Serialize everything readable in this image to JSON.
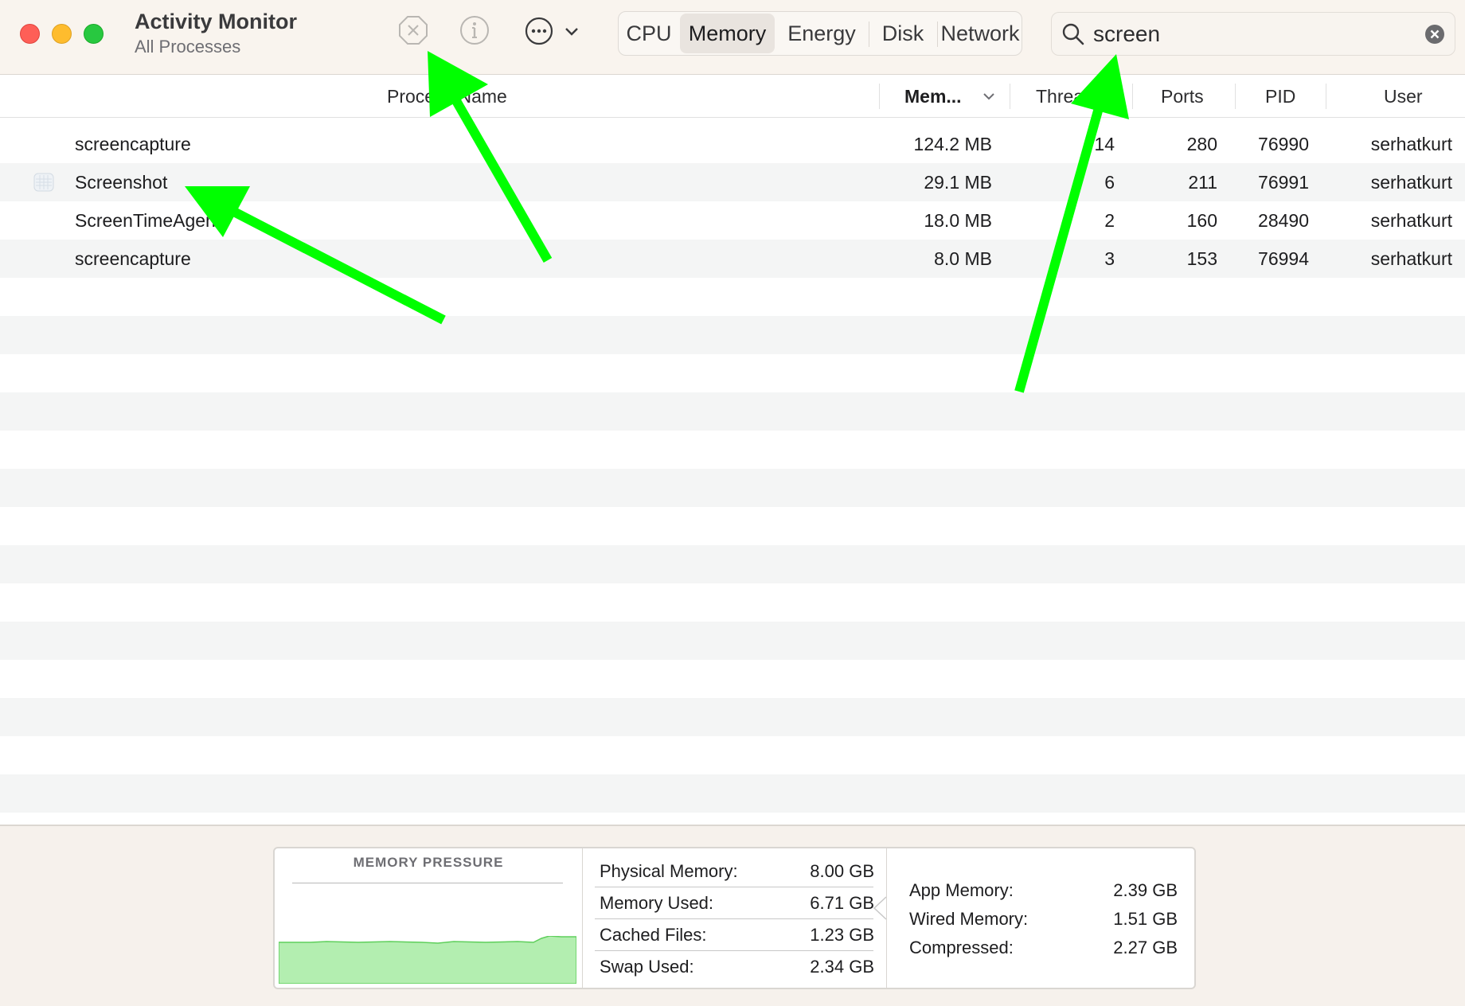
{
  "window": {
    "title": "Activity Monitor",
    "subtitle": "All Processes"
  },
  "toolbar": {
    "stop_icon": "stop-process-icon",
    "info_icon": "info-icon",
    "more_icon": "more-options-icon"
  },
  "tabs": [
    {
      "label": "CPU",
      "active": false
    },
    {
      "label": "Memory",
      "active": true
    },
    {
      "label": "Energy",
      "active": false
    },
    {
      "label": "Disk",
      "active": false
    },
    {
      "label": "Network",
      "active": false
    }
  ],
  "search": {
    "value": "screen"
  },
  "table": {
    "columns": {
      "process_name": "Process Name",
      "memory": "Mem...",
      "threads": "Threads",
      "ports": "Ports",
      "pid": "PID",
      "user": "User"
    },
    "rows": [
      {
        "name": "screencapture",
        "memory": "124.2 MB",
        "threads": "14",
        "ports": "280",
        "pid": "76990",
        "user": "serhatkurt"
      },
      {
        "name": "Screenshot",
        "memory": "29.1 MB",
        "threads": "6",
        "ports": "211",
        "pid": "76991",
        "user": "serhatkurt"
      },
      {
        "name": "ScreenTimeAgent",
        "memory": "18.0 MB",
        "threads": "2",
        "ports": "160",
        "pid": "28490",
        "user": "serhatkurt"
      },
      {
        "name": "screencapture",
        "memory": "8.0 MB",
        "threads": "3",
        "ports": "153",
        "pid": "76994",
        "user": "serhatkurt"
      }
    ]
  },
  "footer": {
    "pressure_title": "MEMORY PRESSURE",
    "physical_memory": {
      "label": "Physical Memory:",
      "value": "8.00 GB"
    },
    "memory_used": {
      "label": "Memory Used:",
      "value": "6.71 GB"
    },
    "cached_files": {
      "label": "Cached Files:",
      "value": "1.23 GB"
    },
    "swap_used": {
      "label": "Swap Used:",
      "value": "2.34 GB"
    },
    "app_memory": {
      "label": "App Memory:",
      "value": "2.39 GB"
    },
    "wired_memory": {
      "label": "Wired Memory:",
      "value": "1.51 GB"
    },
    "compressed": {
      "label": "Compressed:",
      "value": "2.27 GB"
    }
  },
  "colors": {
    "annotation_arrow": "#00ff00",
    "pressure_fill": "#b3eeb0",
    "pressure_stroke": "#5fcf5c"
  }
}
